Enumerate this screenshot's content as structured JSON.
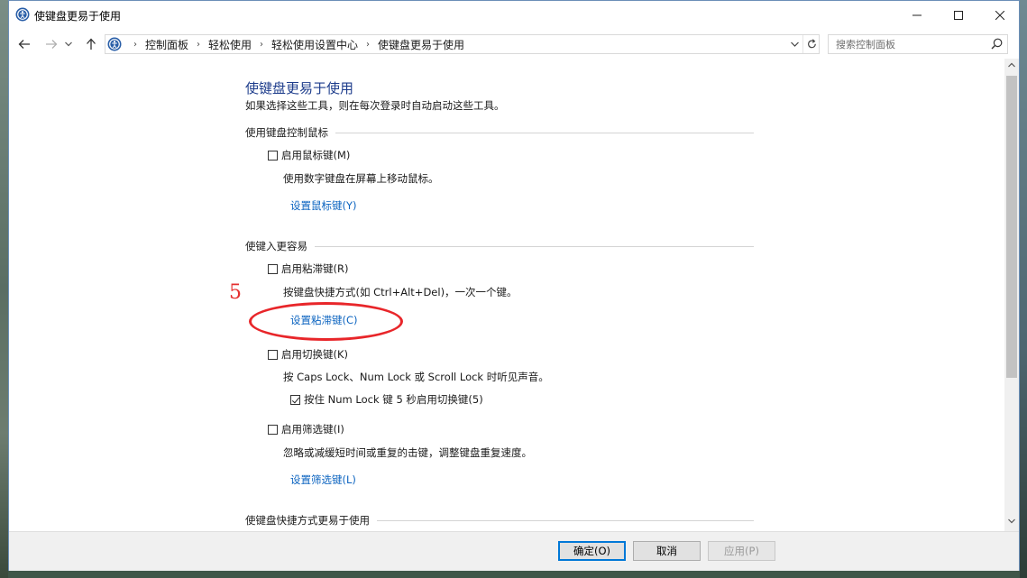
{
  "window": {
    "title": "使键盘更易于使用"
  },
  "address": {
    "breadcrumbs": [
      "控制面板",
      "轻松使用",
      "轻松使用设置中心",
      "使键盘更易于使用"
    ]
  },
  "search": {
    "placeholder": "搜索控制面板"
  },
  "page": {
    "title": "使键盘更易于使用",
    "subtitle": "如果选择这些工具，则在每次登录时自动启动这些工具。",
    "mouse_section": {
      "heading": "使用键盘控制鼠标",
      "checkbox_label": "启用鼠标键(M)",
      "checked": false,
      "description": "使用数字键盘在屏幕上移动鼠标。",
      "link": "设置鼠标键(Y)"
    },
    "typing_section": {
      "heading": "使键入更容易",
      "sticky": {
        "label": "启用粘滞键(R)",
        "checked": false,
        "description": "按键盘快捷方式(如 Ctrl+Alt+Del)，一次一个键。",
        "link": "设置粘滞键(C)"
      },
      "toggle": {
        "label": "启用切换键(K)",
        "checked": false,
        "description": "按 Caps Lock、Num Lock 或 Scroll Lock 时听见声音。",
        "sub_label": "按住 Num Lock 键 5 秒启用切换键(5)",
        "sub_checked": true
      },
      "filter": {
        "label": "启用筛选键(I)",
        "checked": false,
        "description": "忽略或减缓短时间或重复的击键，调整键盘重复速度。",
        "link": "设置筛选键(L)"
      }
    },
    "shortcut_section": {
      "heading": "使键盘快捷方式更易于使用"
    }
  },
  "annotation": {
    "number": "5",
    "color": "#e8262a"
  },
  "buttons": {
    "ok": "确定(O)",
    "cancel": "取消",
    "apply": "应用(P)"
  },
  "colors": {
    "heading": "#1e3d8c",
    "link": "#0c64c0",
    "accent": "#0078d7"
  }
}
